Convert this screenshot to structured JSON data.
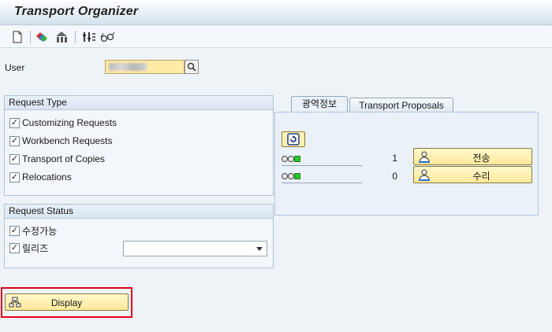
{
  "window": {
    "title": "Transport Organizer"
  },
  "toolbar": {
    "icons": [
      "new-document-icon",
      "variant-icon",
      "hierarchy-icon",
      "settings-filter-icon",
      "glasses-icon"
    ]
  },
  "user": {
    "label": "User",
    "value": "",
    "search_icon": "search-icon"
  },
  "request_type": {
    "title": "Request Type",
    "items": [
      {
        "label": "Customizing Requests",
        "checked": true
      },
      {
        "label": "Workbench Requests",
        "checked": true
      },
      {
        "label": "Transport of Copies",
        "checked": true
      },
      {
        "label": "Relocations",
        "checked": true
      }
    ]
  },
  "request_status": {
    "title": "Request Status",
    "items": [
      {
        "label": "수정가능",
        "checked": true
      },
      {
        "label": "릴리즈",
        "checked": true
      }
    ],
    "release_select": {
      "value": ""
    }
  },
  "tabs": [
    {
      "label": "광역정보",
      "active": true
    },
    {
      "label": "Transport Proposals",
      "active": false
    }
  ],
  "overview": {
    "rows": [
      {
        "count": "1",
        "button": "전송"
      },
      {
        "count": "0",
        "button": "수리"
      }
    ]
  },
  "display_button": {
    "label": "Display"
  },
  "colors": {
    "highlight_border": "#e3001b",
    "button_yellow": "#ffe89a",
    "input_yellow": "#ffeaa6",
    "status_green": "#1fd01f"
  }
}
